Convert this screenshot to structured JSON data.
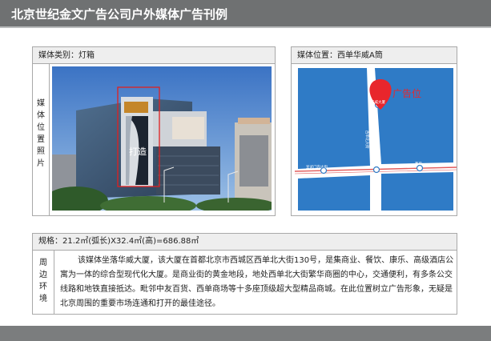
{
  "header": {
    "title": "北京世纪金文广告公司户外媒体广告刊例"
  },
  "left_panel": {
    "header_label": "媒体类别：",
    "header_value": "灯箱",
    "side_label": "媒体位置照片",
    "photo": {
      "sign_text": "打造"
    }
  },
  "right_panel": {
    "header_label": "媒体位置：",
    "header_value": "西单华威A筒",
    "map": {
      "marker_label": "广告位",
      "building_label": "华威大厦",
      "street_ns_label": "西单北大街",
      "street_ns_label_2": "宣武门内大街",
      "street_ew_label": "宣武门内大街",
      "place_label": "西单",
      "colors": {
        "water": "#2f7bc6",
        "road": "#ffffff",
        "rail": "#e25a5a",
        "marker": "#e8262c"
      }
    }
  },
  "spec": {
    "label": "规格：",
    "value": "21.2㎡(弧长)X32.4㎡(高)=686.88㎡"
  },
  "description": {
    "side_label": "周边环境",
    "text": "该媒体坐落华威大厦，该大厦在首都北京市西城区西单北大街130号，是集商业、餐饮、康乐、高级酒店公寓为一体的综合型现代化大厦。是商业街的黄金地段，地处西单北大街繁华商圈的中心，交通便利，有多条公交线路和地铁直接抵达。毗邻中友百货、西单商场等十多座顶级超大型精品商城。在此位置树立广告形象，无疑是北京周围的重要市场连通和打开的最佳途径。"
  }
}
